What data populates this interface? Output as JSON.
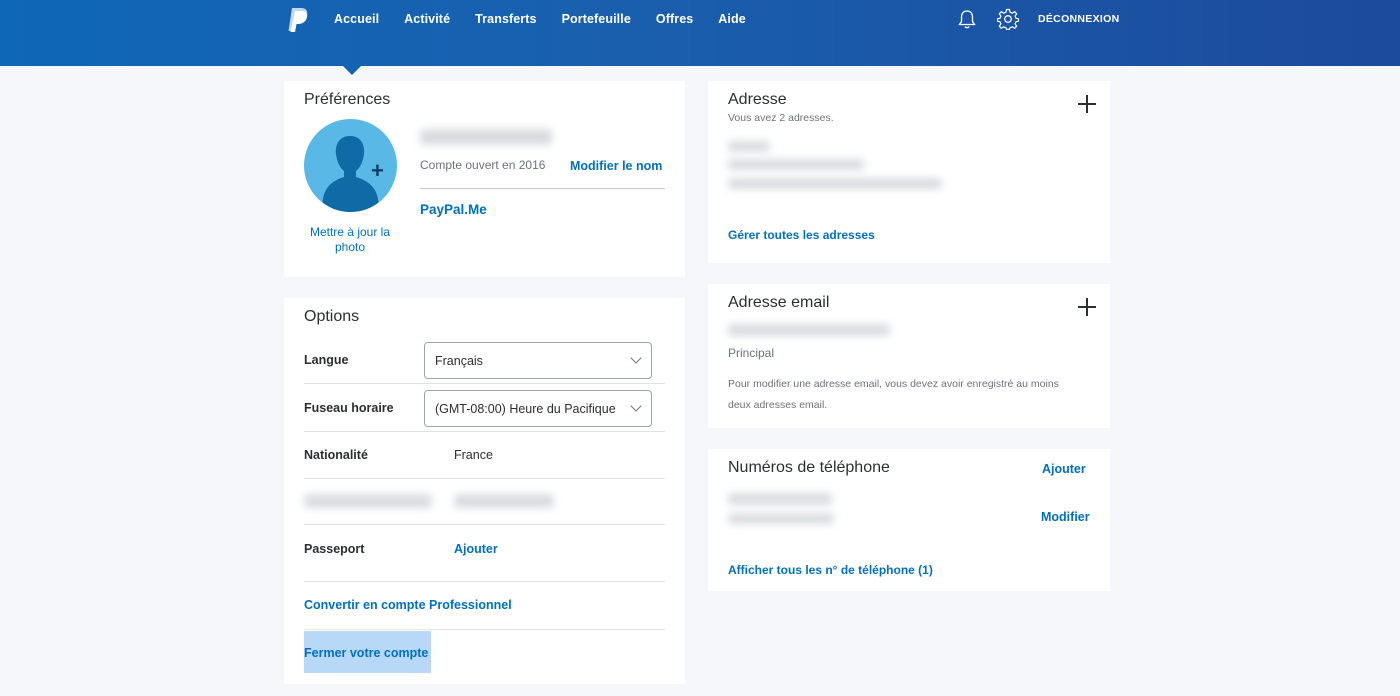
{
  "header": {
    "nav": [
      "Accueil",
      "Activité",
      "Transferts",
      "Portefeuille",
      "Offres",
      "Aide"
    ],
    "logout_label": "DÉCONNEXION",
    "icons": [
      "paypal-logo",
      "bell-icon",
      "gear-icon"
    ],
    "colors": {
      "header_start": "#0f67b7",
      "header_end": "#1c4a9c",
      "link": "#0070ba"
    }
  },
  "preferences": {
    "title": "Préférences",
    "update_photo": "Mettre à jour la photo",
    "account_opened": "Compte ouvert en 2016",
    "edit_name": "Modifier le nom",
    "paypal_me": "PayPal.Me"
  },
  "options": {
    "title": "Options",
    "language_label": "Langue",
    "language_value": "Français",
    "timezone_label": "Fuseau horaire",
    "timezone_value": "(GMT-08:00) Heure du Pacifique",
    "nationality_label": "Nationalité",
    "nationality_value": "France",
    "passport_label": "Passeport",
    "passport_action": "Ajouter",
    "convert_business": "Convertir en compte Professionnel",
    "close_account": "Fermer votre compte"
  },
  "address": {
    "title": "Adresse",
    "subtitle": "Vous avez 2 adresses.",
    "manage_link": "Gérer toutes les adresses"
  },
  "email": {
    "title": "Adresse email",
    "primary": "Principal",
    "note": "Pour modifier une adresse email, vous devez avoir enregistré au moins deux adresses email."
  },
  "phones": {
    "title": "Numéros de téléphone",
    "add": "Ajouter",
    "edit": "Modifier",
    "show_all": "Afficher tous les n° de téléphone (1)"
  }
}
